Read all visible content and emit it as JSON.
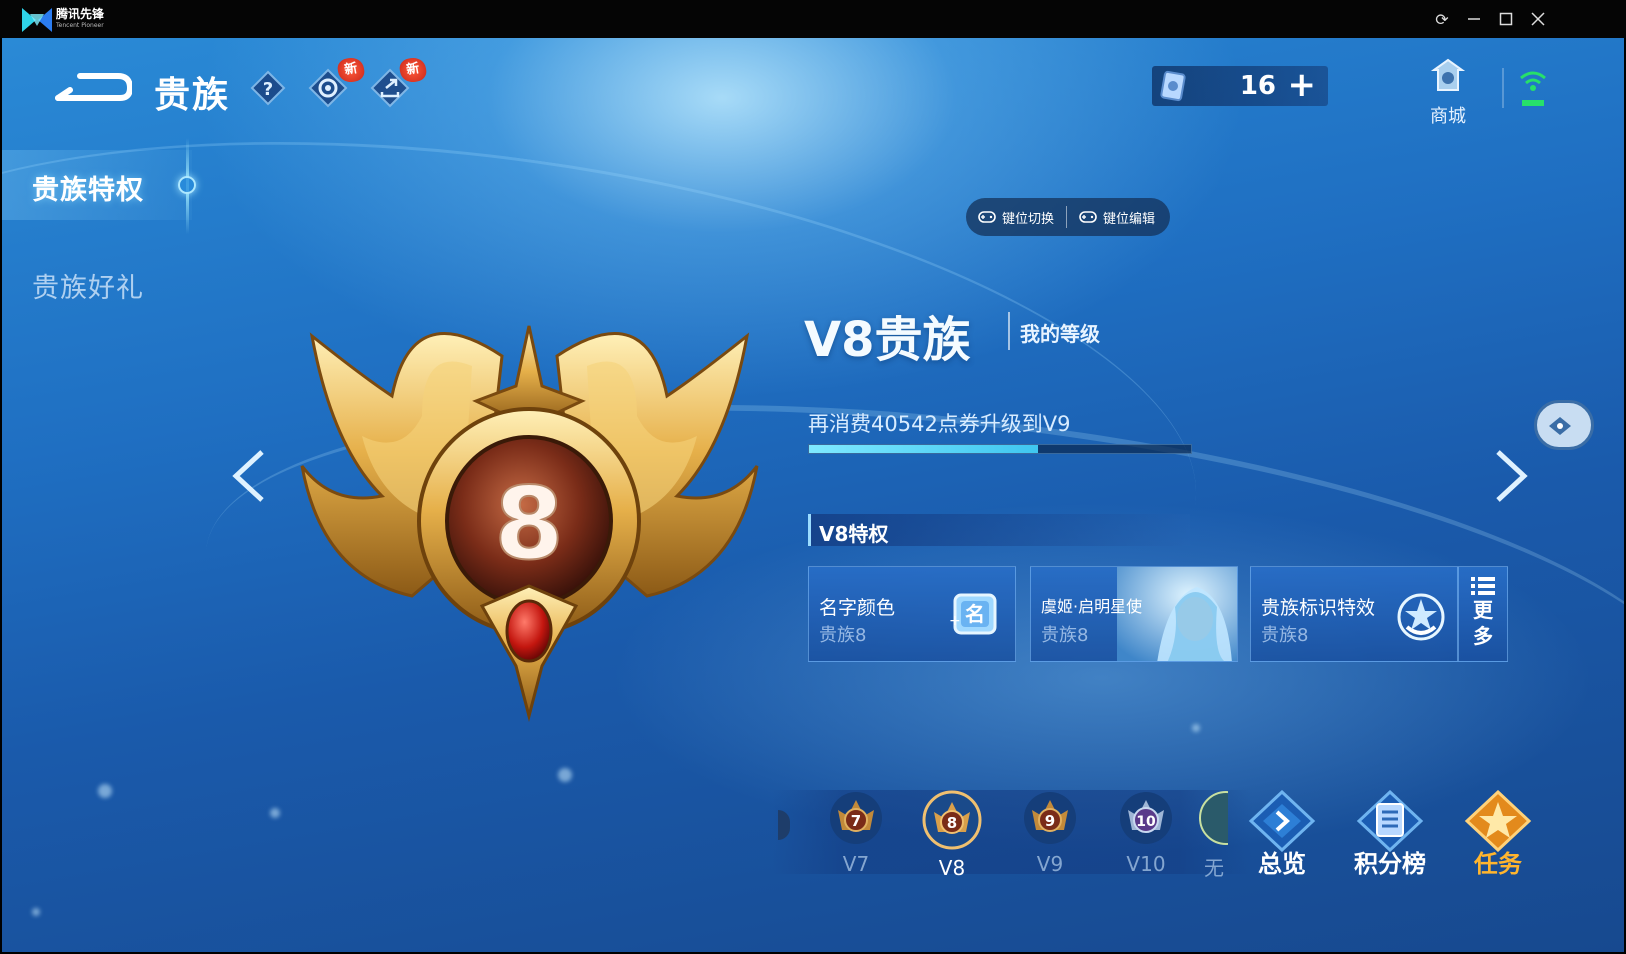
{
  "window": {
    "app_name": "腾讯先锋",
    "app_subtitle": "Tencent Pioneer"
  },
  "header": {
    "title": "贵族",
    "new_badge": "新",
    "coupon_count": "16",
    "shop_label": "商城"
  },
  "sidebar": {
    "items": [
      {
        "label": "贵族特权",
        "active": true
      },
      {
        "label": "贵族好礼",
        "active": false
      }
    ]
  },
  "keymap": {
    "switch_label": "键位切换",
    "edit_label": "键位编辑"
  },
  "level": {
    "emblem_number": "8",
    "title": "V8贵族",
    "my_level": "我的等级",
    "upgrade_text": "再消费40542点券升级到V9",
    "progress": 0.6
  },
  "perks": {
    "heading": "V8特权",
    "cards": [
      {
        "name": "名字颜色",
        "sub": "贵族8"
      },
      {
        "name": "虞姬·启明星使",
        "sub": "贵族8"
      },
      {
        "name": "贵族标识特效",
        "sub": "贵族8"
      }
    ],
    "more_label": "更多",
    "more_chars": [
      "更",
      "多"
    ]
  },
  "level_strip": {
    "items": [
      {
        "label": "V7",
        "num": "7"
      },
      {
        "label": "V8",
        "num": "8",
        "active": true
      },
      {
        "label": "V9",
        "num": "9"
      },
      {
        "label": "V10",
        "num": "10"
      },
      {
        "label": "无",
        "num": ""
      }
    ]
  },
  "bottom_nav": {
    "overview": "总览",
    "leaderboard": "积分榜",
    "tasks": "任务"
  },
  "colors": {
    "accent_cyan": "#7fe9ff",
    "gold": "#f4c25a",
    "task_orange": "#ffb52e",
    "badge_red": "#e2382a"
  }
}
